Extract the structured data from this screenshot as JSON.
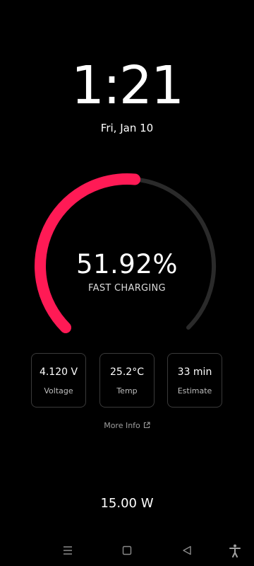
{
  "clock": {
    "time": "1:21",
    "date": "Fri, Jan 10"
  },
  "battery": {
    "percent_text": "51.92%",
    "percent_value": 51.92,
    "mode": "FAST CHARGING",
    "accent_color": "#ff1a55",
    "track_color": "#2a2a2a"
  },
  "stats": [
    {
      "value": "4.120 V",
      "label": "Voltage"
    },
    {
      "value": "25.2°C",
      "label": "Temp"
    },
    {
      "value": "33 min",
      "label": "Estimate"
    }
  ],
  "more_info": {
    "label": "More Info",
    "icon": "external-link-icon"
  },
  "power": {
    "value": "15.00 W"
  },
  "navbar": {
    "icons": [
      "menu-icon",
      "home-icon",
      "back-icon",
      "accessibility-icon"
    ]
  }
}
